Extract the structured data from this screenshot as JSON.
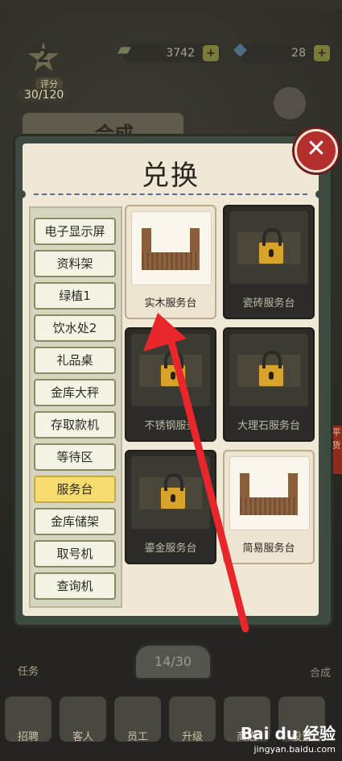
{
  "hud": {
    "level": "2",
    "level_sub": "评分",
    "xp": "30/120",
    "coins": "3742",
    "gems": "28",
    "plus": "+",
    "behind_title": "合成",
    "page_indicator": "14/30",
    "task_label": "任务",
    "right_label": "合成",
    "side_text": "平货"
  },
  "bottom_nav": [
    "招聘",
    "客人",
    "员工",
    "升级",
    "商店",
    "设置"
  ],
  "dialog": {
    "title": "兑换",
    "close_symbol": "✕",
    "categories": [
      {
        "label": "电子显示屏",
        "active": false
      },
      {
        "label": "资料架",
        "active": false
      },
      {
        "label": "绿植1",
        "active": false
      },
      {
        "label": "饮水处2",
        "active": false
      },
      {
        "label": "礼品桌",
        "active": false
      },
      {
        "label": "金库大秤",
        "active": false
      },
      {
        "label": "存取款机",
        "active": false
      },
      {
        "label": "等待区",
        "active": false
      },
      {
        "label": "服务台",
        "active": true
      },
      {
        "label": "金库储架",
        "active": false
      },
      {
        "label": "取号机",
        "active": false
      },
      {
        "label": "查询机",
        "active": false
      }
    ],
    "items": [
      {
        "name": "实木服务台",
        "locked": false
      },
      {
        "name": "瓷砖服务台",
        "locked": true
      },
      {
        "name": "不锈钢服务",
        "locked": true
      },
      {
        "name": "大理石服务台",
        "locked": true
      },
      {
        "name": "鎏金服务台",
        "locked": true
      },
      {
        "name": "简易服务台",
        "locked": false
      }
    ]
  },
  "watermark": {
    "logo": "Bai du 经验",
    "url": "jingyan.baidu.com"
  },
  "colors": {
    "arrow": "#e8262b",
    "active_tab": "#f6dc6f",
    "close": "#b42e2c"
  }
}
